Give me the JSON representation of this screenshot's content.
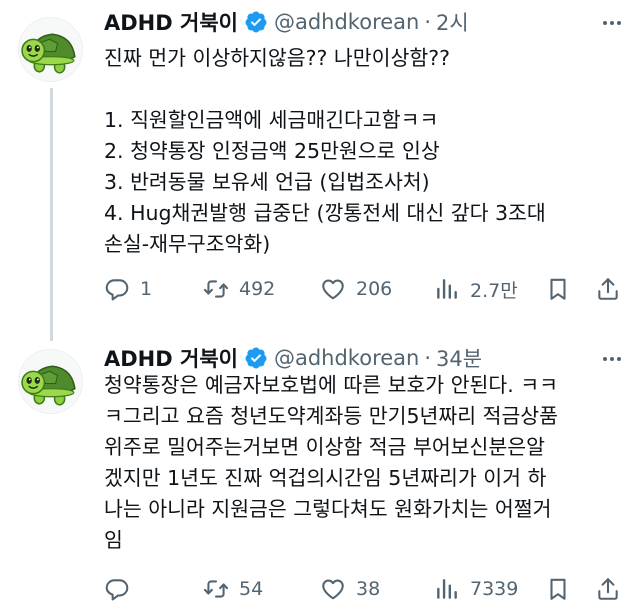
{
  "tweets": [
    {
      "author": {
        "name": "ADHD 거북이",
        "handle": "@adhdkorean",
        "avatar_icon": "turtle-avatar-icon",
        "verified_color": "#1d9bf0"
      },
      "separator": "·",
      "time": "2시",
      "text_lines": [
        "진짜 먼가 이상하지않음?? 나만이상함??",
        "",
        "1. 직원할인금액에 세금매긴다고함ㅋㅋ",
        "2. 청약통장 인정금액 25만원으로 인상",
        "3. 반려동물 보유세 언급 (입법조사처)",
        "4. Hug채권발행 급중단 (깡통전세 대신 갚다 3조대",
        "손실-재무구조악화)"
      ],
      "actions": {
        "replies": "1",
        "retweets": "492",
        "likes": "206",
        "views": "2.7만"
      }
    },
    {
      "author": {
        "name": "ADHD 거북이",
        "handle": "@adhdkorean",
        "avatar_icon": "turtle-avatar-icon",
        "verified_color": "#1d9bf0"
      },
      "separator": "·",
      "time": "34분",
      "text_lines": [
        "청약통장은 예금자보호법에 따른 보호가 안된다. ㅋㅋ",
        "ㅋ그리고 요즘 청년도약계좌등 만기5년짜리 적금상품",
        "위주로 밀어주는거보면 이상함 적금 부어보신분은알",
        "겠지만 1년도 진짜 억겁의시간임 5년짜리가 이거 하",
        "나는 아니라 지원금은 그렇다쳐도 원화가치는 어쩔거",
        "임"
      ],
      "actions": {
        "replies": "",
        "retweets": "54",
        "likes": "38",
        "views": "7339"
      }
    }
  ],
  "colors": {
    "text": "#0f1419",
    "secondary": "#536471",
    "accent": "#1d9bf0",
    "thread_line": "#cfd9de"
  }
}
